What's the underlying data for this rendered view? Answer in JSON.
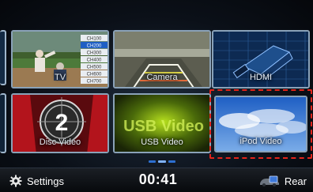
{
  "tiles": [
    {
      "id": "tv",
      "label": "TV"
    },
    {
      "id": "camera",
      "label": "Camera"
    },
    {
      "id": "hdmi",
      "label": "HDMI"
    },
    {
      "id": "disc",
      "label": "Disc Video",
      "number": "2"
    },
    {
      "id": "usb",
      "label": "USB Video",
      "watermark": "USB Video"
    },
    {
      "id": "ipod",
      "label": "iPod Video"
    }
  ],
  "selected_tile": "ipod",
  "tv_channels": [
    "CH100",
    "CH200",
    "CH300",
    "CH400",
    "CH500",
    "CH600",
    "CH700"
  ],
  "bottom_bar": {
    "settings_label": "Settings",
    "clock": "00:41",
    "rear_label": "Rear"
  },
  "colors": {
    "selection": "#e2231a",
    "accent_blue": "#2d6fd0"
  },
  "icons": {
    "settings": "gear-icon",
    "rear": "rear-display-icon"
  }
}
